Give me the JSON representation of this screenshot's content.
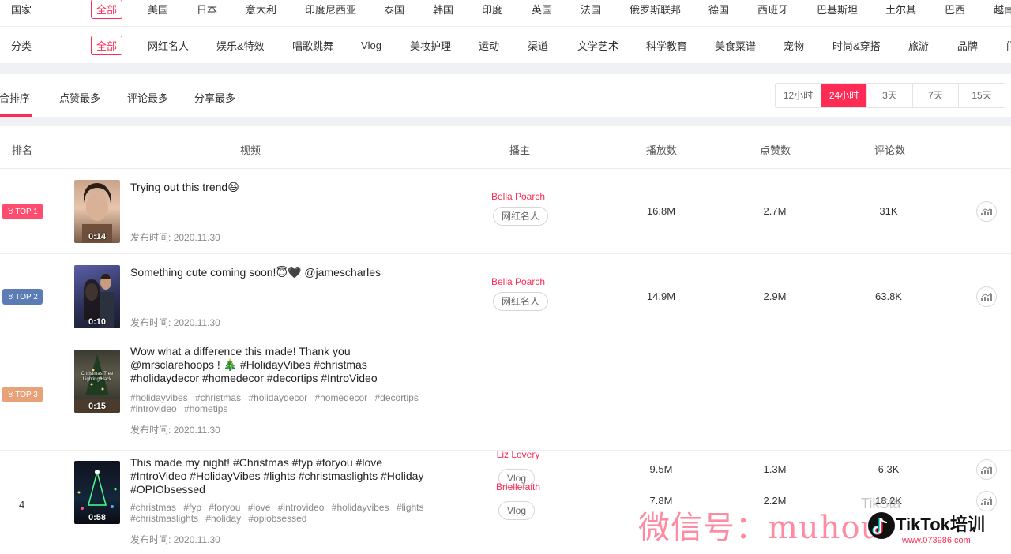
{
  "filters": {
    "country": {
      "label": "国家",
      "options": [
        "全部",
        "美国",
        "日本",
        "意大利",
        "印度尼西亚",
        "泰国",
        "韩国",
        "印度",
        "英国",
        "法国",
        "俄罗斯联邦",
        "德国",
        "西班牙",
        "巴基斯坦",
        "土尔其",
        "巴西",
        "越南"
      ],
      "selected": "全部"
    },
    "category": {
      "label": "分类",
      "options": [
        "全部",
        "网红名人",
        "娱乐&特效",
        "唱歌跳舞",
        "Vlog",
        "美妆护理",
        "运动",
        "渠道",
        "文学艺术",
        "科学教育",
        "美食菜谱",
        "宠物",
        "时尚&穿搭",
        "旅游",
        "品牌",
        "门"
      ],
      "selected": "全部"
    }
  },
  "sort_tabs": [
    "综合排序",
    "点赞最多",
    "评论最多",
    "分享最多"
  ],
  "sort_selected": "综合排序",
  "time_ranges": [
    "12小时",
    "24小时",
    "3天",
    "7天",
    "15天"
  ],
  "time_selected": "24小时",
  "table": {
    "headers": {
      "rank": "排名",
      "video": "视频",
      "creator": "播主",
      "plays": "播放数",
      "likes": "点赞数",
      "comments": "评论数"
    },
    "rows": [
      {
        "rank": "TOP 1",
        "badge_color": "#fe4d6e",
        "duration": "0:14",
        "title": "Trying out this trend😆",
        "tags": "",
        "published": "发布时间: 2020.11.30",
        "creator": "Bella Poarch",
        "category": "网红名人",
        "plays": "16.8M",
        "likes": "2.7M",
        "comments": "31K"
      },
      {
        "rank": "TOP 2",
        "badge_color": "#5b7cb5",
        "duration": "0:10",
        "title": "Something cute coming soon!😇🖤 @jamescharles",
        "tags": "",
        "published": "发布时间: 2020.11.30",
        "creator": "Bella Poarch",
        "category": "网红名人",
        "plays": "14.9M",
        "likes": "2.9M",
        "comments": "63.8K"
      },
      {
        "rank": "TOP 3",
        "badge_color": "#e8a27a",
        "duration": "0:15",
        "thumb_caption": "Christmas Tree Lighting Hack",
        "title": "Wow what a difference this made! Thank you @mrsclarehoops ! 🎄 #HolidayVibes #christmas #holidaydecor #homedecor #decortips #IntroVideo #hometips",
        "tags": "#holidayvibes #christmas #holidaydecor #homedecor #decortips #introvideo #hometips",
        "published": "发布时间: 2020.11.30",
        "creator": "Liz Lovery",
        "category": "Vlog",
        "plays": "9.5M",
        "likes": "1.3M",
        "comments": "6.3K"
      },
      {
        "rank": "4",
        "badge_color": "",
        "duration": "0:58",
        "title": "This made my night! #Christmas #fyp #foryou #love #IntroVideo #HolidayVibes #lights #christmaslights #Holiday #OPIObsessed",
        "tags": "#christmas #fyp #foryou #love #introvideo #holidayvibes #lights #christmaslights #holiday #opiobsessed",
        "published": "发布时间: 2020.11.30",
        "creator": "Briellefaith",
        "category": "Vlog",
        "plays": "7.8M",
        "likes": "2.2M",
        "comments": "18.2K"
      }
    ]
  },
  "watermark": {
    "text": "微信号：muhou",
    "logo": "TikTok培训",
    "url": "www.073986.com",
    "ghost": "TikSta"
  },
  "colors": {
    "accent": "#fe2c55"
  }
}
